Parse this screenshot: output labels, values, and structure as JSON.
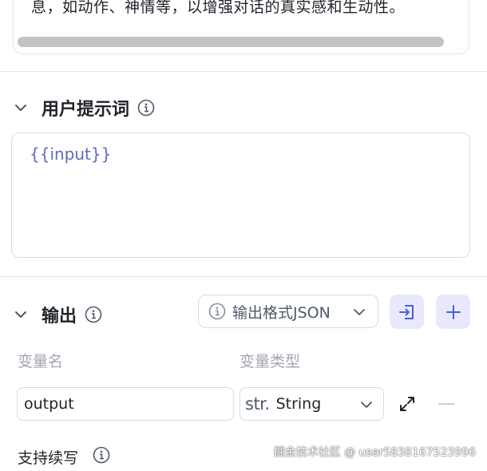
{
  "top_card": {
    "text": "息，如动作、神情等，以增强对话的真实感和生动性。"
  },
  "user_prompt": {
    "title": "用户提示词",
    "content": "{{input}}"
  },
  "output": {
    "title": "输出",
    "format_button_label": "输出格式JSON",
    "columns": {
      "name": "变量名",
      "type": "变量类型"
    },
    "variable": {
      "name": "output",
      "type_prefix": "str.",
      "type_label": "String"
    },
    "continue_label": "支持续写"
  },
  "watermark": "掘金技术社区 @ user5838167523996",
  "colors": {
    "accent": "#5c6bc0",
    "icon_button_bg": "#e8eafb",
    "border": "#d9dbe0",
    "muted_text": "#a3a7af"
  }
}
